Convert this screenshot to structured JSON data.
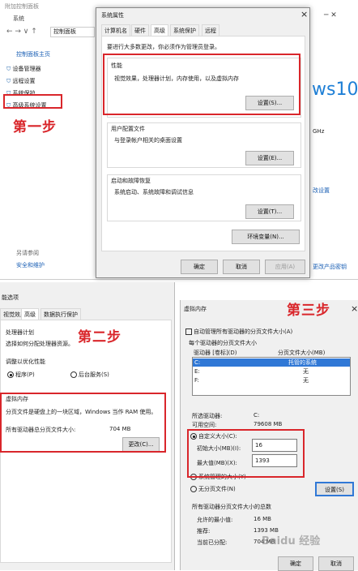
{
  "cp": {
    "titlebar": "附加控制面板",
    "window_title": "系统",
    "path": "控制面板",
    "home": "控制面板主页",
    "links": [
      "设备管理器",
      "远程设置",
      "系统保护",
      "高级系统设置"
    ],
    "see_also": "另请参阅",
    "security": "安全和维护",
    "brand_text": "ws10",
    "ghz": "GHz",
    "change_settings": "改设置",
    "change_key": "更改产品密钥"
  },
  "sysprop": {
    "title": "系统属性",
    "close": "×",
    "tabs": [
      "计算机名",
      "硬件",
      "高级",
      "系统保护",
      "远程"
    ],
    "admin_note": "要进行大多数更改，你必须作为管理员登录。",
    "perf_label": "性能",
    "perf_desc": "视觉效果，处理器计划，内存使用，以及虚拟内存",
    "perf_btn": "设置(S)...",
    "profile_label": "用户配置文件",
    "profile_desc": "与登录帐户相关的桌面设置",
    "profile_btn": "设置(E)...",
    "startup_label": "启动和故障恢复",
    "startup_desc": "系统启动、系统故障和调试信息",
    "startup_btn": "设置(T)...",
    "env_btn": "环境变量(N)...",
    "ok": "确定",
    "cancel": "取消",
    "apply": "应用(A)"
  },
  "perfopt": {
    "title": "能选项",
    "tabs": [
      "视觉效果",
      "高级",
      "数据执行保护"
    ],
    "sched_label": "处理器计划",
    "sched_desc": "选择如何分配处理器资源。",
    "adjust": "调整以优化性能",
    "programs": "程序(P)",
    "services": "后台服务(S)",
    "vm_label": "虚拟内存",
    "vm_desc": "分页文件是硬盘上的一块区域，Windows 当作 RAM 使用。",
    "vm_total_label": "所有驱动器总分页文件大小:",
    "vm_total": "704 MB",
    "change_btn": "更改(C)..."
  },
  "vmem": {
    "title": "虚拟内存",
    "close": "×",
    "auto": "自动管理所有驱动器的分页文件大小(A)",
    "per_drive": "每个驱动器的分页文件大小",
    "col_drive": "驱动器 [卷标](D)",
    "col_size": "分页文件大小(MB)",
    "drives": [
      {
        "d": "C:",
        "s": "托管的系统"
      },
      {
        "d": "E:",
        "s": "无"
      },
      {
        "d": "F:",
        "s": "无"
      }
    ],
    "sel_drive_label": "所选驱动器:",
    "sel_drive": "C:",
    "free_label": "可用空间:",
    "free": "79608 MB",
    "custom": "自定义大小(C):",
    "init_label": "初始大小(MB)(I):",
    "init": "16",
    "max_label": "最大值(MB)(X):",
    "max": "1393",
    "sys_managed": "系统管理的大小(Y)",
    "no_paging": "无分页文件(N)",
    "set_btn": "设置(S)",
    "total_label": "所有驱动器分页文件大小的总数",
    "min_label": "允许的最小值:",
    "min": "16 MB",
    "rec_label": "推荐:",
    "rec": "1393 MB",
    "cur_label": "当前已分配:",
    "cur": "704 MB",
    "ok": "确定",
    "cancel": "取消"
  },
  "steps": [
    "第一步",
    "第二步",
    "第三步"
  ],
  "watermark": "Baidu 经验"
}
